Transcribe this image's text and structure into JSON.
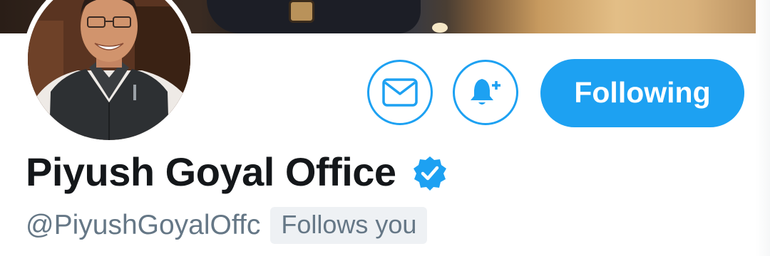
{
  "banner": {
    "description_icon": "header-photo"
  },
  "avatar": {
    "icon": "profile-photo"
  },
  "actions": {
    "message_icon": "envelope-icon",
    "notification_icon": "bell-plus-icon",
    "follow_label": "Following"
  },
  "profile": {
    "display_name": "Piyush Goyal Office",
    "verified_icon": "verified-badge-icon",
    "handle": "@PiyushGoyalOffc",
    "follows_you_label": "Follows you"
  },
  "colors": {
    "accent": "#1da1f2",
    "name_text": "#14171a",
    "secondary_text": "#657786",
    "badge_bg": "#eef1f4"
  }
}
